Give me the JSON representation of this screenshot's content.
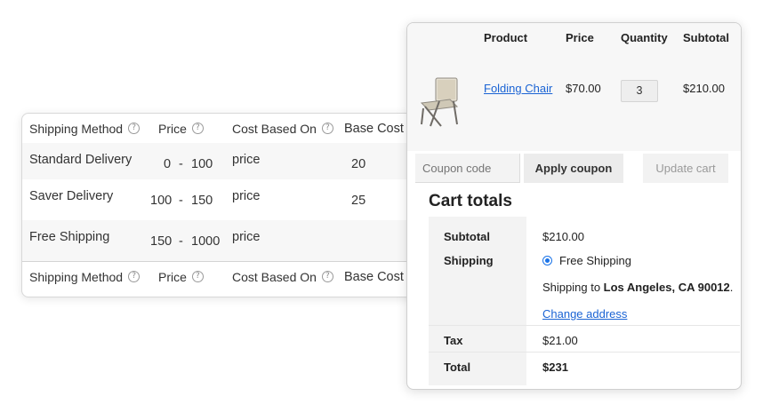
{
  "shipping_table": {
    "headers": {
      "method": "Shipping Method",
      "price": "Price",
      "cost_based_on": "Cost Based On",
      "base_cost": "Base Cost"
    },
    "help_glyph": "?",
    "range_separator": "-",
    "rows": [
      {
        "method": "Standard Delivery",
        "min": "0",
        "max": "100",
        "based_on": "price",
        "base_cost": "20"
      },
      {
        "method": "Saver Delivery",
        "min": "100",
        "max": "150",
        "based_on": "price",
        "base_cost": "25"
      },
      {
        "method": "Free Shipping",
        "min": "150",
        "max": "1000",
        "based_on": "price",
        "base_cost": ""
      }
    ]
  },
  "cart": {
    "headers": {
      "product": "Product",
      "price": "Price",
      "quantity": "Quantity",
      "subtotal": "Subtotal"
    },
    "item": {
      "name": "Folding Chair",
      "price": "$70.00",
      "quantity": "3",
      "subtotal": "$210.00",
      "thumbnail_icon": "folding-chair-image"
    },
    "coupon_placeholder": "Coupon code",
    "apply_coupon": "Apply coupon",
    "update_cart": "Update cart"
  },
  "cart_totals": {
    "title": "Cart totals",
    "subtotal_label": "Subtotal",
    "subtotal_value": "$210.00",
    "shipping_label": "Shipping",
    "shipping_option": "Free Shipping",
    "shipping_to_prefix": "Shipping to ",
    "shipping_to_location": "Los Angeles, CA 90012",
    "shipping_to_suffix": ".",
    "change_address": "Change address",
    "tax_label": "Tax",
    "tax_value": "$21.00",
    "total_label": "Total",
    "total_value": "$231"
  },
  "colors": {
    "link": "#1a63d4",
    "radio": "#1a73e8",
    "row_alt": "#f7f7f7"
  }
}
